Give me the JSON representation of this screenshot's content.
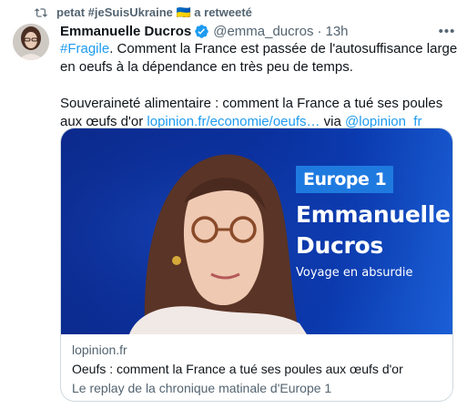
{
  "retweet": {
    "by": "petat #jeSuisUkraine 🇺🇦 a retweeté"
  },
  "author": {
    "name": "Emmanuelle Ducros",
    "handle": "@emma_ducros",
    "dot": "·",
    "time": "13h"
  },
  "tweet": {
    "hashtag": "#Fragile",
    "line1_rest": ". Comment la France est passée de l'autosuffisance large en oeufs à la dépendance en très peu de temps.",
    "line2": "Souveraineté alimentaire : comment la France a tué ses poules aux œufs d'or ",
    "link": "lopinion.fr/economie/oeufs…",
    "via": " via ",
    "mention": "@lopinion_fr"
  },
  "card": {
    "image": {
      "logo": "Europe 1",
      "name_first": "Emmanuelle",
      "name_last": "Ducros",
      "show": "Voyage en absurdie"
    },
    "domain": "lopinion.fr",
    "title": "Oeufs : comment la France a tué ses poules aux œufs d'or",
    "description": "Le replay de la chronique matinale d'Europe 1"
  },
  "colors": {
    "link": "#1d9bf0",
    "muted": "#536471",
    "text": "#0f1419",
    "verified": "#1d9bf0",
    "card_bg": "#0a2f9b"
  },
  "icons": {
    "retweet": "retweet-icon",
    "verified": "verified-badge-icon",
    "more": "more-options-icon"
  }
}
